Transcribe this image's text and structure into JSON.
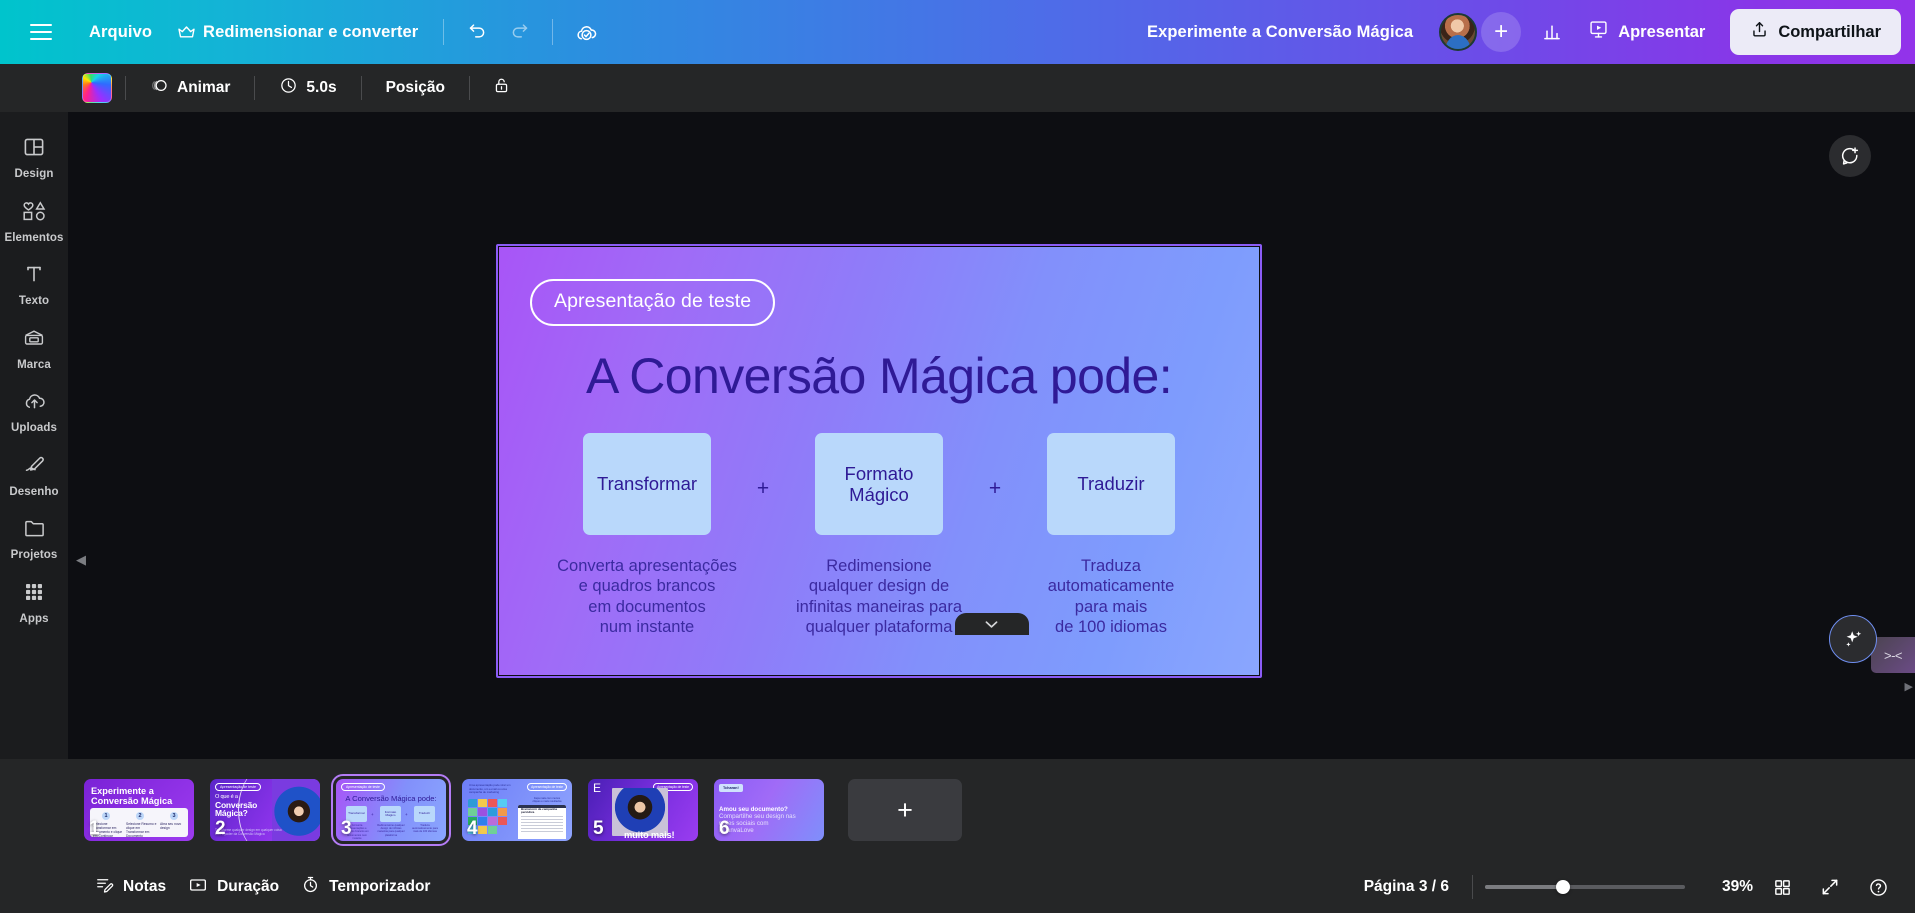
{
  "topbar": {
    "menu_icon": "hamburger-menu-icon",
    "file_label": "Arquivo",
    "resize_label": "Redimensionar e converter",
    "resize_icon": "crown-icon",
    "undo_icon": "undo-icon",
    "redo_icon": "redo-icon",
    "cloud_saved_icon": "cloud-check-icon",
    "doc_title": "Experimente a Conversão Mágica",
    "avatar_name": "avatar",
    "add_collaborator_label": "+",
    "insights_icon": "bar-chart-icon",
    "present_label": "Apresentar",
    "present_icon": "present-screen-icon",
    "share_label": "Compartilhar",
    "share_icon": "share-upload-icon",
    "gradient_start": "#00c4cc",
    "gradient_end": "#9333ea"
  },
  "toolbar": {
    "color_swatch_name": "rainbow-color-swatch",
    "animate_label": "Animar",
    "animate_icon": "animate-circle-icon",
    "duration_label": "5.0s",
    "duration_icon": "clock-icon",
    "position_label": "Posição",
    "lock_icon": "lock-open-icon"
  },
  "sidebar": {
    "items": [
      {
        "label": "Design",
        "icon": "design-layout-icon"
      },
      {
        "label": "Elementos",
        "icon": "shapes-icon"
      },
      {
        "label": "Texto",
        "icon": "text-t-icon"
      },
      {
        "label": "Marca",
        "icon": "brand-card-icon"
      },
      {
        "label": "Uploads",
        "icon": "cloud-upload-icon"
      },
      {
        "label": "Desenho",
        "icon": "draw-pen-icon"
      },
      {
        "label": "Projetos",
        "icon": "folder-icon"
      },
      {
        "label": "Apps",
        "icon": "apps-grid-icon"
      }
    ]
  },
  "canvas": {
    "comment_fab_icon": "add-comment-icon",
    "magic_fab_icon": "magic-sparkles-icon",
    "kaomoji_label": ">-<",
    "kaomoji_caret": "▶",
    "collapse_strip_icon": "chevron-down-icon",
    "scroll_left_icon": "◀"
  },
  "slide": {
    "pill_label": "Apresentação de teste",
    "title": "A Conversão Mágica pode:",
    "bg_gradient_from": "#a855f7",
    "bg_gradient_to": "#8aa6fe",
    "card_bg": "#b9d8fb",
    "text_color": "#2f1a96",
    "columns": [
      {
        "card_label": "Transformar",
        "description": "Converta apresentações\ne quadros brancos\nem documentos\nnum instante"
      },
      {
        "card_label": "Formato\nMágico",
        "description": "Redimensione\nqualquer design de\ninfinitas maneiras para\nqualquer plataforma"
      },
      {
        "card_label": "Traduzir",
        "description": "Traduza\nautomaticamente\npara mais\nde 100 idiomas"
      }
    ],
    "separators": [
      "+",
      "+"
    ]
  },
  "thumbnails": {
    "add_label": "+",
    "items": [
      {
        "number": "1",
        "title": "Experimente a\nConversão Mágica",
        "steps": [
          {
            "num": "1",
            "text": "Selecione Transformar em Documento e clique em Continuar"
          },
          {
            "num": "2",
            "text": "Selecione Resumo e clique em Transformar em Documento"
          },
          {
            "num": "3",
            "text": "Abra seu novo design"
          }
        ]
      },
      {
        "number": "2",
        "badge": "Apresentação de teste",
        "title_line1": "O que é a",
        "title_line2": "Conversão",
        "title_line3": "Mágica?",
        "subtitle": "Transforme qualquer design em qualquer coisa com o poder da Conversão Mágica"
      },
      {
        "number": "3",
        "badge": "Apresentação de teste",
        "title": "A Conversão Mágica pode:",
        "cards": [
          "Transformar",
          "Formato Mágico",
          "Traduzir"
        ],
        "selected": true
      },
      {
        "number": "4",
        "badge": "Apresentação de teste",
        "top_copy": "Uma apresentação pode virar um documento, um e-mail ou uma campanha de marketing",
        "right_copy": "Faça mais com menos cliques e mais resultados",
        "doc_title": "Brainstorm da campanha periódica"
      },
      {
        "number": "5",
        "badge": "Apresentação de teste",
        "letter": "E",
        "more_label": "muito mais!"
      },
      {
        "number": "6",
        "chip": "Tcharan!",
        "copy_line1": "Amou seu documento?",
        "copy_line2": "Compartilhe seu design nas",
        "copy_line3": "redes sociais com",
        "copy_line4": "#CanvaLove"
      }
    ]
  },
  "bottombar": {
    "notes_label": "Notas",
    "notes_icon": "notes-pencil-icon",
    "duration_label": "Duração",
    "duration_icon": "video-play-icon",
    "timer_label": "Temporizador",
    "timer_icon": "stopwatch-icon",
    "page_indicator": "Página 3 / 6",
    "zoom_percent": "39%",
    "zoom_value": 39,
    "grid_view_icon": "grid-view-icon",
    "fullscreen_icon": "fullscreen-expand-icon",
    "help_icon": "help-question-icon"
  }
}
